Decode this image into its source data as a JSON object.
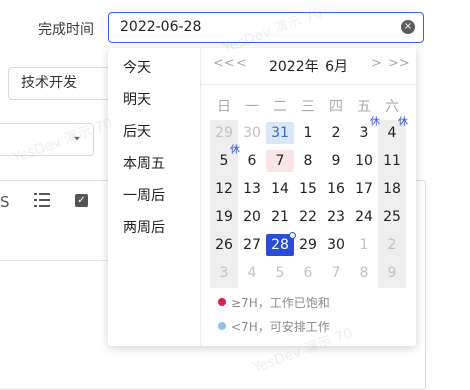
{
  "form": {
    "field_label": "完成时间",
    "date_value": "2022-06-28",
    "clear_icon": "×",
    "select_value": "技术开发",
    "select2_arrow": "▾",
    "toolbar_letter": "S",
    "toolbar_check": "✓"
  },
  "watermark": {
    "text": "YesDev 演示 70"
  },
  "shortcuts": [
    "今天",
    "明天",
    "后天",
    "本周五",
    "一周后",
    "两周后"
  ],
  "calendar": {
    "nav_prev_year": "<<",
    "nav_prev_month": "<",
    "nav_next_month": ">",
    "nav_next_year": ">>",
    "year_label": "2022年",
    "month_label": "6月",
    "weekdays": [
      "日",
      "一",
      "二",
      "三",
      "四",
      "五",
      "六"
    ],
    "rest_tag": "休",
    "weeks": [
      [
        {
          "d": "29",
          "o": true
        },
        {
          "d": "30",
          "o": true
        },
        {
          "d": "31",
          "o": true,
          "s": "today"
        },
        {
          "d": "1"
        },
        {
          "d": "2"
        },
        {
          "d": "3",
          "r": true
        },
        {
          "d": "4",
          "r": true
        }
      ],
      [
        {
          "d": "5",
          "r": true
        },
        {
          "d": "6"
        },
        {
          "d": "7",
          "s": "busy"
        },
        {
          "d": "8"
        },
        {
          "d": "9"
        },
        {
          "d": "10"
        },
        {
          "d": "11"
        }
      ],
      [
        {
          "d": "12"
        },
        {
          "d": "13"
        },
        {
          "d": "14"
        },
        {
          "d": "15"
        },
        {
          "d": "16"
        },
        {
          "d": "17"
        },
        {
          "d": "18"
        }
      ],
      [
        {
          "d": "19"
        },
        {
          "d": "20"
        },
        {
          "d": "21"
        },
        {
          "d": "22"
        },
        {
          "d": "23"
        },
        {
          "d": "24"
        },
        {
          "d": "25"
        }
      ],
      [
        {
          "d": "26"
        },
        {
          "d": "27"
        },
        {
          "d": "28",
          "s": "selected"
        },
        {
          "d": "29"
        },
        {
          "d": "30"
        },
        {
          "d": "1",
          "o": true
        },
        {
          "d": "2",
          "o": true
        }
      ],
      [
        {
          "d": "3",
          "o": true
        },
        {
          "d": "4",
          "o": true
        },
        {
          "d": "5",
          "o": true
        },
        {
          "d": "6",
          "o": true
        },
        {
          "d": "7",
          "o": true
        },
        {
          "d": "8",
          "o": true
        },
        {
          "d": "9",
          "o": true
        }
      ]
    ]
  },
  "legend": [
    {
      "color": "#d9214f",
      "text": "≥7H，工作已饱和"
    },
    {
      "color": "#8ec1ee",
      "text": "<7H，可安排工作"
    }
  ],
  "colors": {
    "accent": "#2b4ed8",
    "input_border": "#3461e0"
  }
}
